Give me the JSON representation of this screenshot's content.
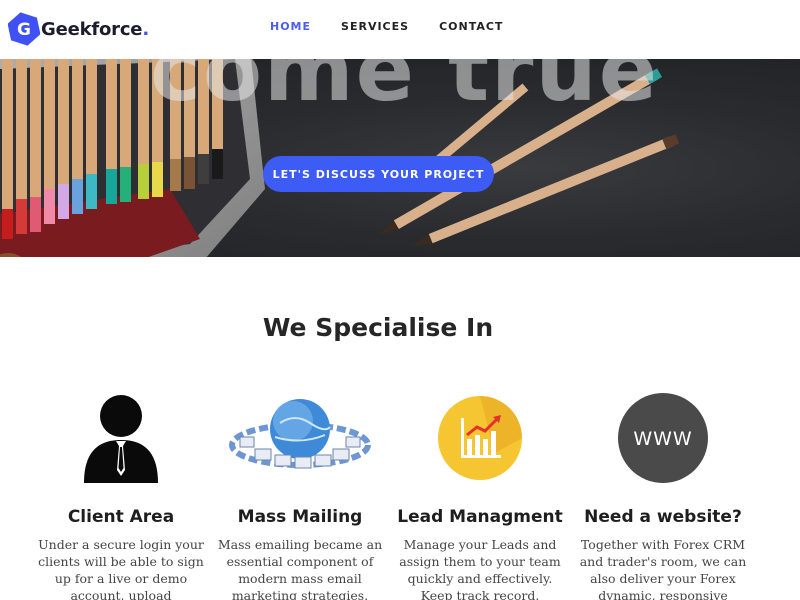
{
  "header": {
    "logo_letter": "G",
    "logo_text": "Geekforce",
    "logo_dot": ".",
    "nav": [
      {
        "label": "HOME"
      },
      {
        "label": "SERVICES"
      },
      {
        "label": "CONTACT"
      }
    ],
    "accent": "#3f51f4"
  },
  "hero": {
    "title": "come true",
    "cta_label": "LET'S DISCUSS YOUR PROJECT",
    "cta_color": "#3c5cf5"
  },
  "specialise": {
    "title": "We Specialise In",
    "cards": [
      {
        "icon": "user-silhouette-icon",
        "title": "Client Area",
        "text": "Under a secure login your clients will be able to sign up for a live or demo account, upload"
      },
      {
        "icon": "mass-mailing-globe-icon",
        "title": "Mass Mailing",
        "text": "Mass emailing became an essential component of modern mass email marketing strategies."
      },
      {
        "icon": "growth-chart-icon",
        "title": "Lead Managment",
        "text": "Manage your Leads and assign them to your team quickly and effectively. Keep track record."
      },
      {
        "icon": "www-globe-icon",
        "icon_text": "WWW",
        "title": "Need a website?",
        "text": "Together with Forex CRM and trader's room, we can also deliver your Forex dynamic, responsive"
      }
    ]
  }
}
